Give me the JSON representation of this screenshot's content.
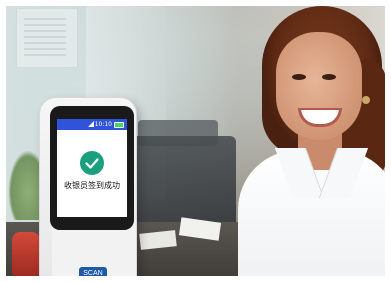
{
  "device": {
    "status_time": "10:10",
    "screen_message": "收银员签到成功",
    "scan_label": "SCAN"
  },
  "colors": {
    "status_bar": "#2f54d9",
    "check_circle": "#1aa07f",
    "scan_button": "#1e5aa8",
    "battery": "#3ddc5a"
  },
  "icons": {
    "signal": "signal-icon",
    "battery": "battery-icon",
    "check": "check-icon"
  }
}
